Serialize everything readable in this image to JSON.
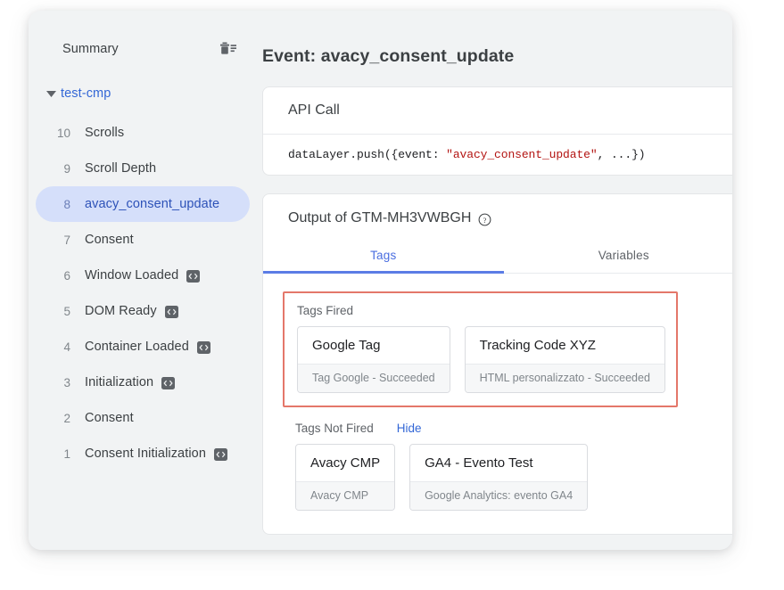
{
  "sidebar": {
    "summary_label": "Summary",
    "clear_icon": "trash-list-icon",
    "container": {
      "label": "test-cmp",
      "expanded": true
    },
    "events": [
      {
        "num": "10",
        "label": "Scrolls",
        "code_badge": false
      },
      {
        "num": "9",
        "label": "Scroll Depth",
        "code_badge": false
      },
      {
        "num": "8",
        "label": "avacy_consent_update",
        "code_badge": false,
        "selected": true
      },
      {
        "num": "7",
        "label": "Consent",
        "code_badge": false
      },
      {
        "num": "6",
        "label": "Window Loaded",
        "code_badge": true
      },
      {
        "num": "5",
        "label": "DOM Ready",
        "code_badge": true
      },
      {
        "num": "4",
        "label": "Container Loaded",
        "code_badge": true
      },
      {
        "num": "3",
        "label": "Initialization",
        "code_badge": true
      },
      {
        "num": "2",
        "label": "Consent",
        "code_badge": false
      },
      {
        "num": "1",
        "label": "Consent Initialization",
        "code_badge": true
      }
    ]
  },
  "main": {
    "event_title": "Event: avacy_consent_update",
    "api_call": {
      "heading": "API Call",
      "code_prefix": "dataLayer.push({event: ",
      "code_string": "\"avacy_consent_update\"",
      "code_suffix": ", ...})"
    },
    "output": {
      "heading": "Output of GTM-MH3VWBGH",
      "help_icon": "help-circle-icon",
      "tabs": [
        {
          "label": "Tags",
          "active": true
        },
        {
          "label": "Variables",
          "active": false
        }
      ],
      "tags_fired": {
        "label": "Tags Fired",
        "tags": [
          {
            "name": "Google Tag",
            "status": "Tag Google - Succeeded"
          },
          {
            "name": "Tracking Code XYZ",
            "status": "HTML personalizzato - Succeeded"
          }
        ]
      },
      "tags_not_fired": {
        "label": "Tags Not Fired",
        "hide_label": "Hide",
        "tags": [
          {
            "name": "Avacy CMP",
            "status": "Avacy CMP"
          },
          {
            "name": "GA4 - Evento Test",
            "status": "Google Analytics: evento GA4"
          }
        ]
      }
    }
  },
  "colors": {
    "accent_blue": "#3367d6",
    "tab_blue": "#4a6ee0",
    "selected_pill": "#d5dffa",
    "highlight_red": "#e4776a",
    "code_string_red": "#b31412"
  }
}
